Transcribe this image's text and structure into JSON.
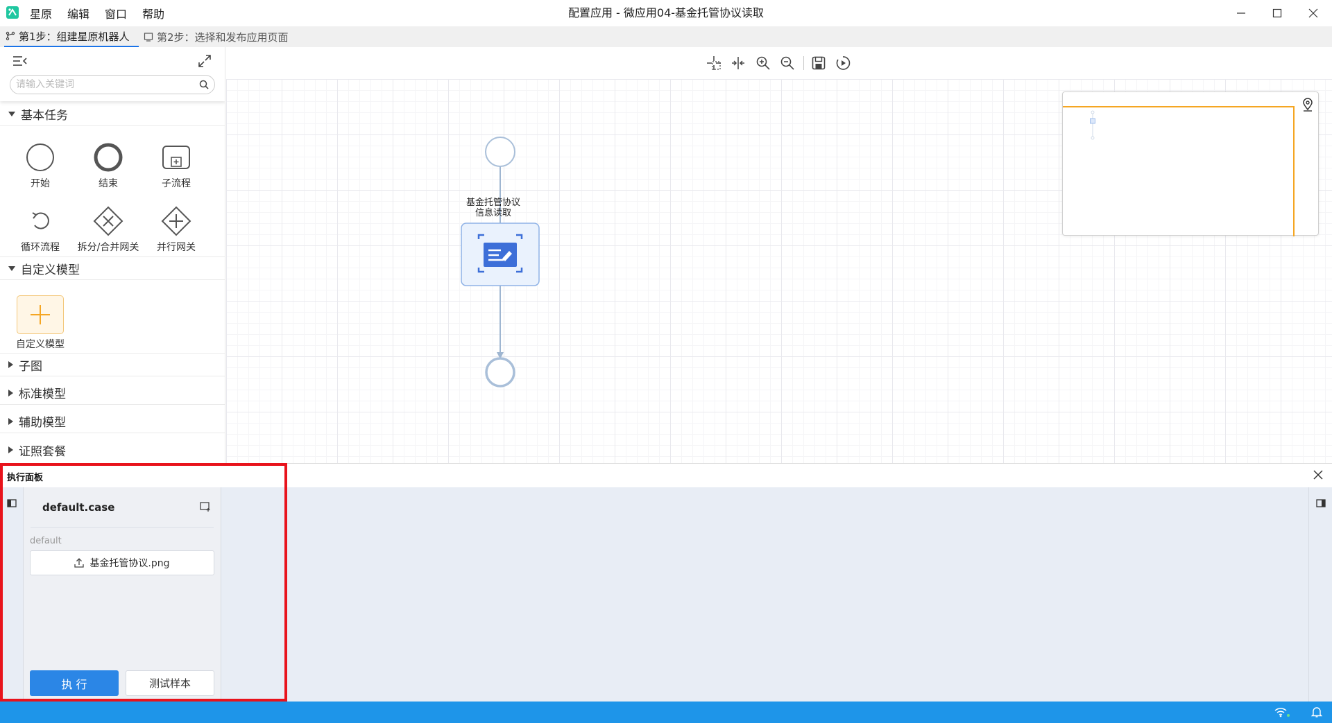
{
  "window": {
    "menu": [
      "星原",
      "编辑",
      "窗口",
      "帮助"
    ],
    "title": "配置应用 - 微应用04-基金托管协议读取",
    "controls": [
      "minimize-icon",
      "maximize-icon",
      "close-icon"
    ]
  },
  "steps": [
    {
      "label": "第1步：组建星原机器人",
      "icon": "branch-icon",
      "active": true
    },
    {
      "label": "第2步：选择和发布应用页面",
      "icon": "page-icon",
      "active": false
    }
  ],
  "palette": {
    "search_placeholder": "请输入关键词",
    "sections": [
      {
        "title": "基本任务",
        "expanded": true,
        "items": [
          "开始",
          "结束",
          "子流程",
          "循环流程",
          "拆分/合并网关",
          "并行网关"
        ]
      },
      {
        "title": "自定义模型",
        "expanded": true,
        "items": [
          "自定义模型"
        ]
      },
      {
        "title": "子图",
        "expanded": false
      },
      {
        "title": "标准模型",
        "expanded": false
      },
      {
        "title": "辅助模型",
        "expanded": false
      },
      {
        "title": "证照套餐",
        "expanded": false
      }
    ]
  },
  "canvas": {
    "toolbar": [
      "select-area-icon",
      "fit-width-icon",
      "zoom-in-icon",
      "zoom-out-icon",
      "save-icon",
      "run-icon"
    ],
    "node_label": "基金托管协议信息读取"
  },
  "exec_panel": {
    "title": "执行面板",
    "case_name": "default.case",
    "group_label": "default",
    "upload_file": "基金托管协议.png",
    "run_button": "执 行",
    "sample_button": "测试样本"
  },
  "colors": {
    "accent": "#2b86e6",
    "status_bar": "#1e95e9",
    "highlight_box": "#e8131c",
    "minimap_viewport": "#f5a623",
    "flow_line": "#9fb6d1"
  }
}
